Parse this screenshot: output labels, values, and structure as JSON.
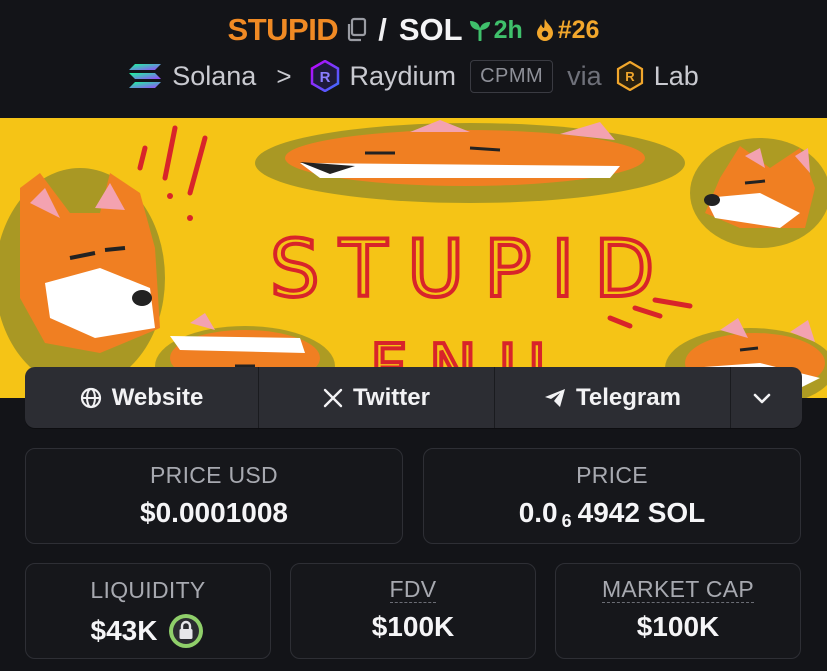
{
  "header": {
    "ticker": "STUPID",
    "separator": "/",
    "quote": "SOL",
    "age": "2h",
    "rank": "#26",
    "icons": {
      "copy": "copy-icon",
      "age": "seedling-icon",
      "rank": "flame-icon"
    }
  },
  "chain": {
    "network": "Solana",
    "chevron": ">",
    "dex": "Raydium",
    "pool_type": "CPMM",
    "via": "via",
    "launchpad": "Lab"
  },
  "banner": {
    "text_line1": "STUPID",
    "text_line2": "FNU",
    "description": "stupid fox meme banner"
  },
  "social": {
    "website": "Website",
    "twitter": "Twitter",
    "telegram": "Telegram",
    "icons": [
      "globe-icon",
      "x-icon",
      "telegram-icon",
      "chevron-down-icon"
    ]
  },
  "stats": {
    "price_usd": {
      "label": "PRICE USD",
      "value": "$0.0001008"
    },
    "price": {
      "label": "PRICE",
      "prefix": "0.0",
      "zeros": "6",
      "suffix": "4942 SOL"
    },
    "liquidity": {
      "label": "LIQUIDITY",
      "value": "$43K"
    },
    "fdv": {
      "label": "FDV",
      "value": "$100K"
    },
    "market_cap": {
      "label": "MARKET CAP",
      "value": "$100K"
    }
  },
  "colors": {
    "background": "#131418",
    "ticker": "#f08a24",
    "age_green": "#3fc06b",
    "rank_orange": "#f2a72c",
    "banner_yellow": "#f5c416",
    "lock_green": "#8fcf6a"
  }
}
